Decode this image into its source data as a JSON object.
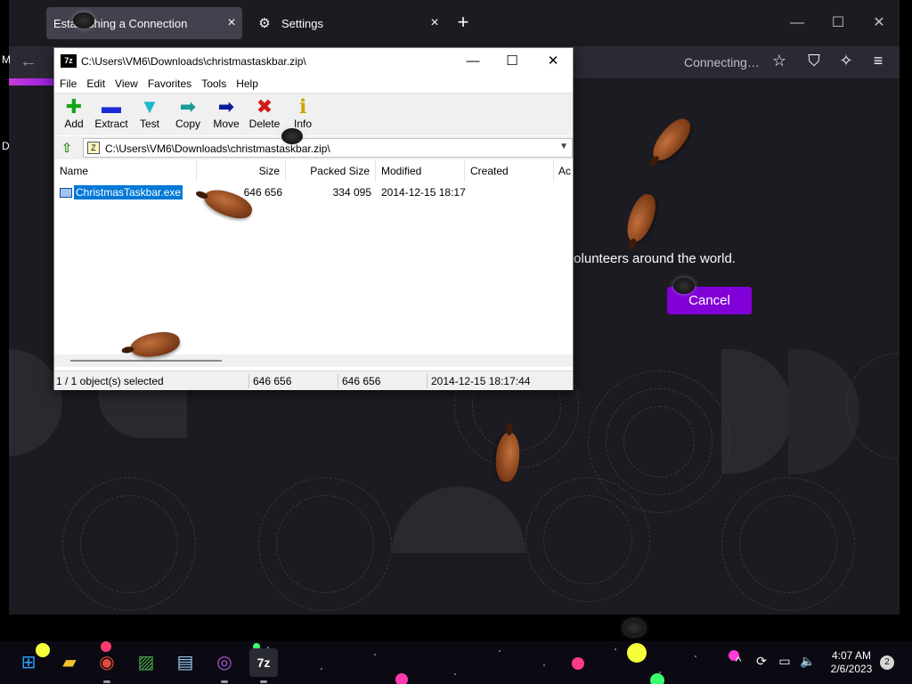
{
  "browser": {
    "tabs": [
      {
        "label": "Establishing a Connection",
        "close": "×"
      },
      {
        "label": "Settings",
        "close": "×",
        "icon": "gear-icon"
      }
    ],
    "new_tab": "+",
    "window_controls": {
      "minimize": "—",
      "maximize": "☐",
      "close": "✕"
    },
    "nav": {
      "back": "←",
      "status": "Connecting…"
    },
    "content": {
      "message": "of volunteers around the world.",
      "cancel_label": "Cancel",
      "accent": "#8000d7"
    },
    "edge_letters": [
      "M",
      "D"
    ]
  },
  "zip": {
    "title": "C:\\Users\\VM6\\Downloads\\christmastaskbar.zip\\",
    "app_icon_text": "7z",
    "window_controls": {
      "minimize": "—",
      "maximize": "☐",
      "close": "✕"
    },
    "menu": [
      "File",
      "Edit",
      "View",
      "Favorites",
      "Tools",
      "Help"
    ],
    "toolbar": [
      {
        "label": "Add",
        "icon": "add-icon",
        "glyph": "✚",
        "color": "#1aa31a"
      },
      {
        "label": "Extract",
        "icon": "extract-icon",
        "glyph": "▬",
        "color": "#1a2bd6"
      },
      {
        "label": "Test",
        "icon": "test-icon",
        "glyph": "▼",
        "color": "#1bb8c8"
      },
      {
        "label": "Copy",
        "icon": "copy-icon",
        "glyph": "➡",
        "color": "#1a9a9a"
      },
      {
        "label": "Move",
        "icon": "move-icon",
        "glyph": "➡",
        "color": "#0a1a9a"
      },
      {
        "label": "Delete",
        "icon": "delete-icon",
        "glyph": "✖",
        "color": "#d21a1a"
      },
      {
        "label": "Info",
        "icon": "info-icon",
        "glyph": "ℹ",
        "color": "#c8a800"
      }
    ],
    "address": "C:\\Users\\VM6\\Downloads\\christmastaskbar.zip\\",
    "columns": [
      "Name",
      "Size",
      "Packed Size",
      "Modified",
      "Created",
      "Ac"
    ],
    "rows": [
      {
        "name": "ChristmasTaskbar.exe",
        "size": "646 656",
        "packed": "334 095",
        "modified": "2014-12-15 18:17",
        "created": ""
      }
    ],
    "status": {
      "selected": "1 / 1 object(s) selected",
      "size": "646 656",
      "packed": "646 656",
      "modified": "2014-12-15 18:17:44"
    }
  },
  "taskbar": {
    "apps": [
      {
        "name": "start-button",
        "icon": "windows-logo-icon"
      },
      {
        "name": "file-explorer",
        "icon": "folder-icon"
      },
      {
        "name": "chrome",
        "icon": "chrome-icon"
      },
      {
        "name": "photo-app",
        "icon": "image-icon"
      },
      {
        "name": "remote-app",
        "icon": "monitor-icon"
      },
      {
        "name": "tor-browser",
        "icon": "tor-icon"
      },
      {
        "name": "7zip",
        "icon": "7zip-icon",
        "text": "7z"
      }
    ],
    "tray": {
      "chevron": "^",
      "notifications_count": "2"
    },
    "clock": {
      "time": "4:07 AM",
      "date": "2/6/2023"
    }
  }
}
